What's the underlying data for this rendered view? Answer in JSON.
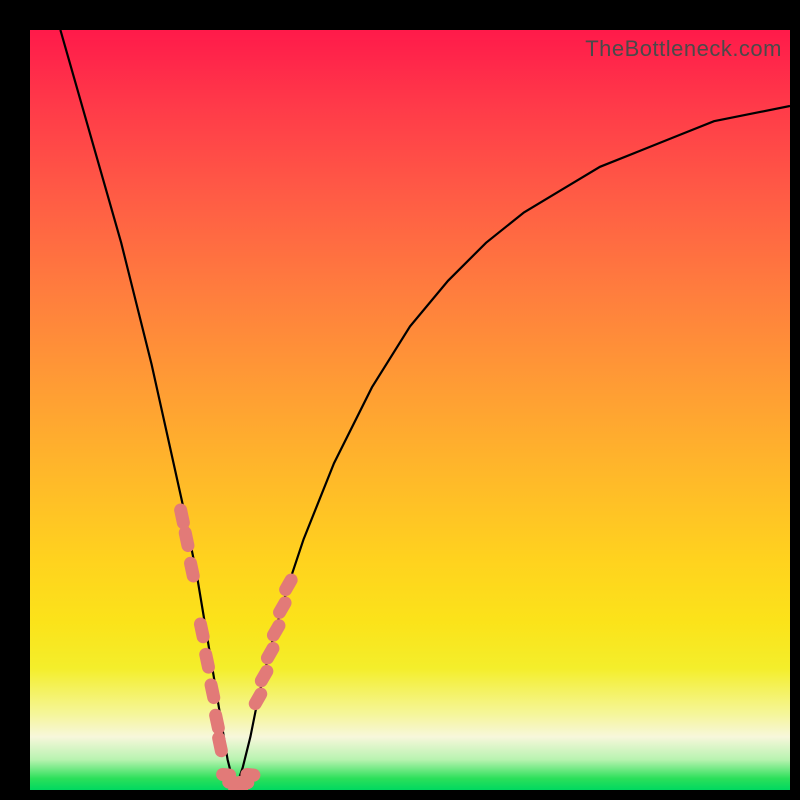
{
  "watermark": "TheBottleneck.com",
  "colors": {
    "frame": "#000000",
    "curve": "#000000",
    "marker": "#e27a78",
    "gradient_top": "#ff1a4a",
    "gradient_bottom": "#00d860"
  },
  "chart_data": {
    "type": "line",
    "title": "",
    "xlabel": "",
    "ylabel": "",
    "xlim": [
      0,
      100
    ],
    "ylim": [
      0,
      100
    ],
    "note": "Numeric axes are unlabeled in the source; x and y normalised 0–100. y≈100 at top (max bottleneck / red), y≈0 at bottom (optimal / green). Curve has a V-shaped minimum near x≈27.",
    "series": [
      {
        "name": "bottleneck-curve",
        "x": [
          4,
          6,
          8,
          10,
          12,
          14,
          16,
          18,
          20,
          22,
          24,
          25,
          26,
          27,
          28,
          29,
          30,
          32,
          34,
          36,
          40,
          45,
          50,
          55,
          60,
          65,
          70,
          75,
          80,
          85,
          90,
          95,
          100
        ],
        "y": [
          100,
          93,
          86,
          79,
          72,
          64,
          56,
          47,
          38,
          28,
          16,
          10,
          4,
          0,
          3,
          7,
          12,
          20,
          27,
          33,
          43,
          53,
          61,
          67,
          72,
          76,
          79,
          82,
          84,
          86,
          88,
          89,
          90
        ]
      },
      {
        "name": "markers-left-branch",
        "x": [
          20.0,
          20.6,
          21.3,
          22.6,
          23.3,
          24.0,
          24.6,
          25.0
        ],
        "y": [
          36,
          33,
          29,
          21,
          17,
          13,
          9,
          6
        ]
      },
      {
        "name": "markers-right-branch",
        "x": [
          30.0,
          30.8,
          31.6,
          32.4,
          33.2,
          34.0
        ],
        "y": [
          12,
          15,
          18,
          21,
          24,
          27
        ]
      },
      {
        "name": "markers-bottom",
        "x": [
          25.8,
          26.6,
          27.4,
          28.2,
          29.0
        ],
        "y": [
          2,
          1,
          0,
          1,
          2
        ]
      }
    ]
  }
}
